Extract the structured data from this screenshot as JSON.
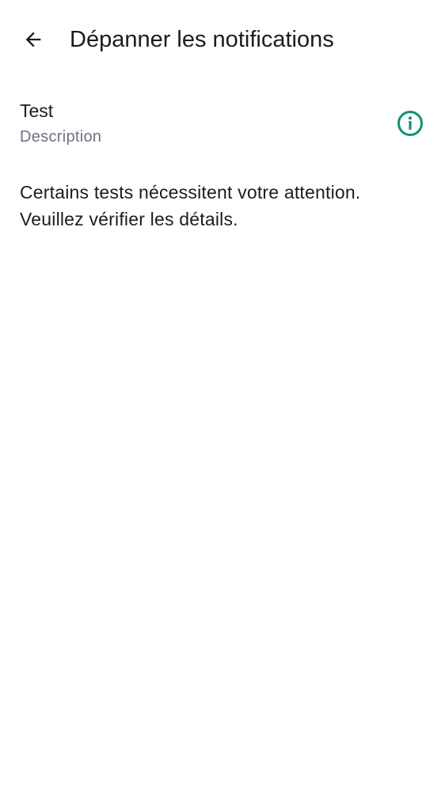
{
  "header": {
    "title": "Dépanner les notifications",
    "back_icon": "arrow-back-icon"
  },
  "tests": [
    {
      "title": "Test",
      "description": "Description",
      "status_icon": "info-icon",
      "status_color": "#0a9474"
    }
  ],
  "message": "Certains tests nécessitent votre attention. Veuillez vérifier les détails."
}
